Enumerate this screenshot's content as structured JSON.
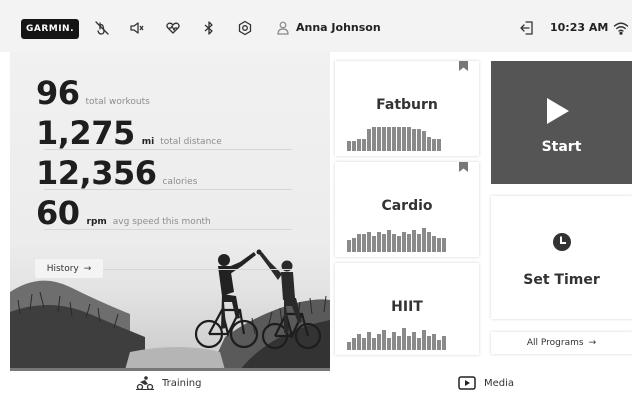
{
  "topbar": {
    "logo": "GARMIN.",
    "icons": [
      "no-touch-icon",
      "mute-icon",
      "heart-rate-icon",
      "bluetooth-icon",
      "settings-icon",
      "user-icon",
      "logout-icon",
      "wifi-icon"
    ],
    "user_name": "Anna Johnson",
    "time": "10:23 AM"
  },
  "stats": [
    {
      "value": "96",
      "unit": "",
      "label": "total workouts"
    },
    {
      "value": "1,275",
      "unit": "mi",
      "label": "total distance"
    },
    {
      "value": "12,356",
      "unit": "",
      "label": "calories"
    },
    {
      "value": "60",
      "unit": "rpm",
      "label": "avg speed this month"
    }
  ],
  "history_button": {
    "label": "History",
    "arrow": "→"
  },
  "hero_progress": 1.0,
  "programs": [
    {
      "name": "Fatburn",
      "bookmarked": true,
      "bars": [
        10,
        10,
        12,
        12,
        22,
        24,
        24,
        24,
        24,
        24,
        24,
        24,
        24,
        22,
        22,
        20,
        14,
        12,
        12
      ]
    },
    {
      "name": "Cardio",
      "bookmarked": true,
      "bars": [
        12,
        14,
        18,
        18,
        20,
        16,
        20,
        18,
        22,
        18,
        16,
        20,
        18,
        22,
        18,
        24,
        20,
        16,
        14,
        14
      ]
    },
    {
      "name": "HIIT",
      "bookmarked": false,
      "bars": [
        8,
        12,
        16,
        12,
        18,
        12,
        16,
        20,
        12,
        18,
        14,
        22,
        14,
        18,
        12,
        20,
        14,
        16,
        10,
        14
      ]
    }
  ],
  "start": {
    "label": "Start"
  },
  "timer": {
    "label": "Set Timer"
  },
  "all_programs": {
    "label": "All Programs",
    "arrow": "→"
  },
  "bottom_nav": [
    {
      "label": "Training",
      "icon": "cyclist-icon"
    },
    {
      "label": "Media",
      "icon": "play-screen-icon"
    }
  ],
  "colors": {
    "accent": "#555555",
    "text": "#222222",
    "muted": "#8d8d8d"
  }
}
